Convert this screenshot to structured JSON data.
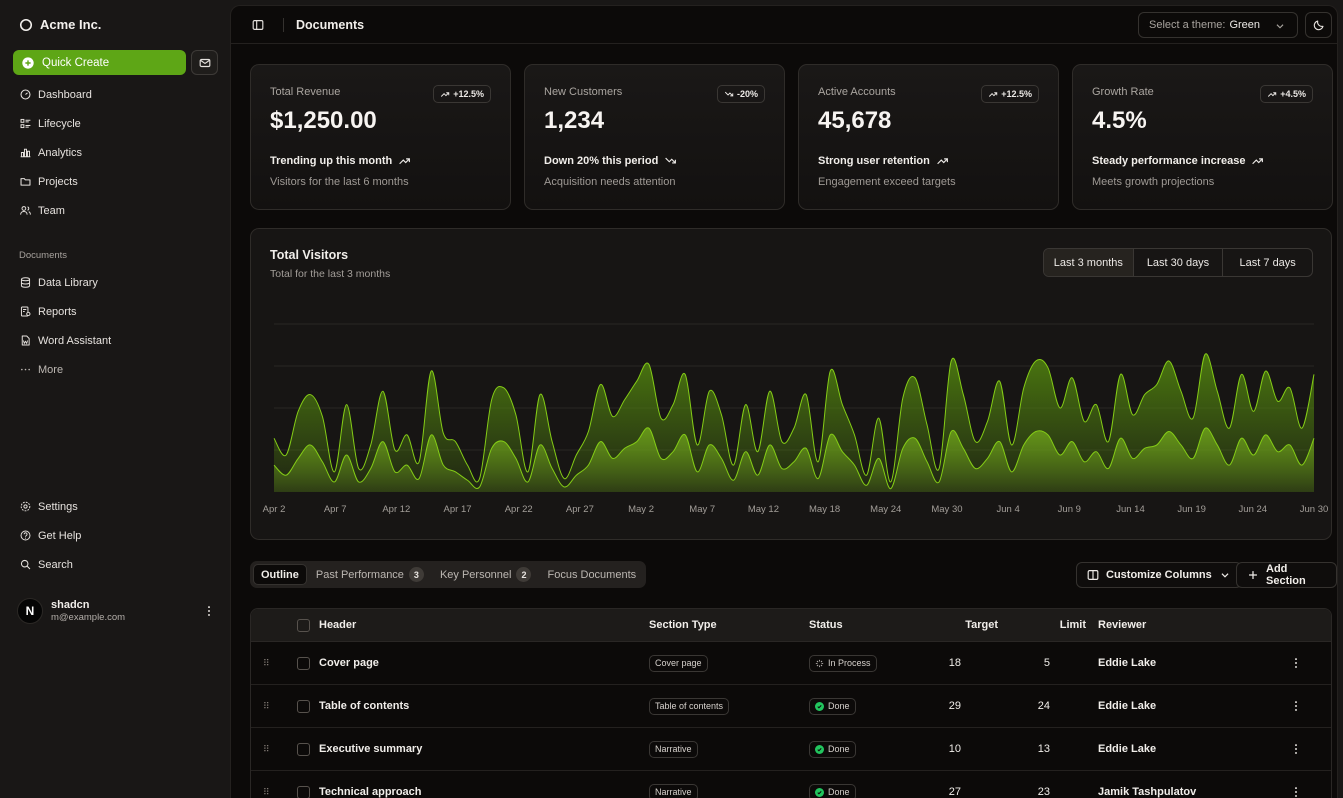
{
  "sidebar": {
    "brand": "Acme Inc.",
    "quick_create": "Quick Create",
    "main_items": [
      {
        "label": "Dashboard",
        "icon": "dashboard-icon"
      },
      {
        "label": "Lifecycle",
        "icon": "list-details-icon"
      },
      {
        "label": "Analytics",
        "icon": "chart-bar-icon"
      },
      {
        "label": "Projects",
        "icon": "folder-icon"
      },
      {
        "label": "Team",
        "icon": "users-icon"
      }
    ],
    "documents_group": "Documents",
    "document_items": [
      {
        "label": "Data Library",
        "icon": "database-icon"
      },
      {
        "label": "Reports",
        "icon": "report-icon"
      },
      {
        "label": "Word Assistant",
        "icon": "file-word-icon"
      },
      {
        "label": "More",
        "icon": "dots-icon"
      }
    ],
    "secondary_items": [
      {
        "label": "Settings",
        "icon": "settings-icon"
      },
      {
        "label": "Get Help",
        "icon": "help-icon"
      },
      {
        "label": "Search",
        "icon": "search-icon"
      }
    ],
    "user": {
      "initial": "N",
      "name": "shadcn",
      "email": "m@example.com"
    }
  },
  "header": {
    "title": "Documents",
    "theme_label": "Select a theme:",
    "theme_value": "Green"
  },
  "cards": [
    {
      "label": "Total Revenue",
      "value": "$1,250.00",
      "badge": "+12.5%",
      "direction": "up",
      "trend": "Trending up this month",
      "sub": "Visitors for the last 6 months"
    },
    {
      "label": "New Customers",
      "value": "1,234",
      "badge": "-20%",
      "direction": "down",
      "trend": "Down 20% this period",
      "sub": "Acquisition needs attention"
    },
    {
      "label": "Active Accounts",
      "value": "45,678",
      "badge": "+12.5%",
      "direction": "up",
      "trend": "Strong user retention",
      "sub": "Engagement exceed targets"
    },
    {
      "label": "Growth Rate",
      "value": "4.5%",
      "badge": "+4.5%",
      "direction": "up",
      "trend": "Steady performance increase",
      "sub": "Meets growth projections"
    }
  ],
  "visitors": {
    "title": "Total Visitors",
    "subtitle": "Total for the last 3 months",
    "ranges": [
      "Last 3 months",
      "Last 30 days",
      "Last 7 days"
    ],
    "selected_range": "Last 3 months"
  },
  "chart_data": {
    "type": "area",
    "title": "Total Visitors",
    "x_ticks": [
      "Apr 2",
      "Apr 7",
      "Apr 12",
      "Apr 17",
      "Apr 22",
      "Apr 27",
      "May 2",
      "May 7",
      "May 12",
      "May 18",
      "May 24",
      "May 30",
      "Jun 4",
      "Jun 9",
      "Jun 14",
      "Jun 19",
      "Jun 24",
      "Jun 30"
    ],
    "colors": {
      "outer": "#4d7c0f",
      "inner": "#6b9e1a",
      "line": "#84cc16"
    },
    "series": [
      {
        "values": [
          0.32,
          0.22,
          0.48,
          0.58,
          0.45,
          0.12,
          0.52,
          0.14,
          0.28,
          0.6,
          0.25,
          0.34,
          0.18,
          0.72,
          0.35,
          0.3,
          0.16,
          0.08,
          0.55,
          0.62,
          0.46,
          0.12,
          0.58,
          0.3,
          0.08,
          0.22,
          0.36,
          0.64,
          0.45,
          0.55,
          0.66,
          0.76,
          0.44,
          0.52,
          0.7,
          0.28,
          0.6,
          0.46,
          0.16,
          0.52,
          0.24,
          0.6,
          0.3,
          0.38,
          0.58,
          0.18,
          0.72,
          0.52,
          0.34,
          0.1,
          0.44,
          0.06,
          0.56,
          0.68,
          0.4,
          0.14,
          0.78,
          0.58,
          0.3,
          0.42,
          0.66,
          0.28,
          0.62,
          0.78,
          0.74,
          0.5,
          0.68,
          0.42,
          0.52,
          0.3,
          0.7,
          0.46,
          0.58,
          0.64,
          0.78,
          0.6,
          0.44,
          0.82,
          0.6,
          0.38,
          0.7,
          0.48,
          0.72,
          0.54,
          0.62,
          0.38,
          0.7
        ]
      },
      {
        "values": [
          0.16,
          0.1,
          0.2,
          0.28,
          0.18,
          0.06,
          0.22,
          0.06,
          0.14,
          0.3,
          0.12,
          0.16,
          0.08,
          0.34,
          0.16,
          0.12,
          0.07,
          0.03,
          0.26,
          0.3,
          0.2,
          0.06,
          0.28,
          0.14,
          0.03,
          0.1,
          0.16,
          0.3,
          0.2,
          0.26,
          0.3,
          0.38,
          0.2,
          0.24,
          0.34,
          0.12,
          0.28,
          0.2,
          0.07,
          0.24,
          0.1,
          0.28,
          0.14,
          0.18,
          0.26,
          0.08,
          0.34,
          0.24,
          0.16,
          0.04,
          0.2,
          0.02,
          0.26,
          0.32,
          0.18,
          0.06,
          0.36,
          0.26,
          0.14,
          0.2,
          0.3,
          0.12,
          0.28,
          0.36,
          0.34,
          0.22,
          0.3,
          0.18,
          0.24,
          0.14,
          0.32,
          0.2,
          0.26,
          0.28,
          0.36,
          0.28,
          0.2,
          0.38,
          0.28,
          0.16,
          0.32,
          0.22,
          0.34,
          0.24,
          0.28,
          0.16,
          0.32
        ]
      }
    ]
  },
  "view_tabs": [
    {
      "label": "Outline",
      "count": null
    },
    {
      "label": "Past Performance",
      "count": "3"
    },
    {
      "label": "Key Personnel",
      "count": "2"
    },
    {
      "label": "Focus Documents",
      "count": null
    }
  ],
  "actions": {
    "customize": "Customize Columns",
    "add": "Add Section"
  },
  "table": {
    "columns": [
      "Header",
      "Section Type",
      "Status",
      "Target",
      "Limit",
      "Reviewer"
    ],
    "rows": [
      {
        "header": "Cover page",
        "type": "Cover page",
        "status": "In Process",
        "target": "18",
        "limit": "5",
        "reviewer": "Eddie Lake"
      },
      {
        "header": "Table of contents",
        "type": "Table of contents",
        "status": "Done",
        "target": "29",
        "limit": "24",
        "reviewer": "Eddie Lake"
      },
      {
        "header": "Executive summary",
        "type": "Narrative",
        "status": "Done",
        "target": "10",
        "limit": "13",
        "reviewer": "Eddie Lake"
      },
      {
        "header": "Technical approach",
        "type": "Narrative",
        "status": "Done",
        "target": "27",
        "limit": "23",
        "reviewer": "Jamik Tashpulatov"
      }
    ]
  }
}
